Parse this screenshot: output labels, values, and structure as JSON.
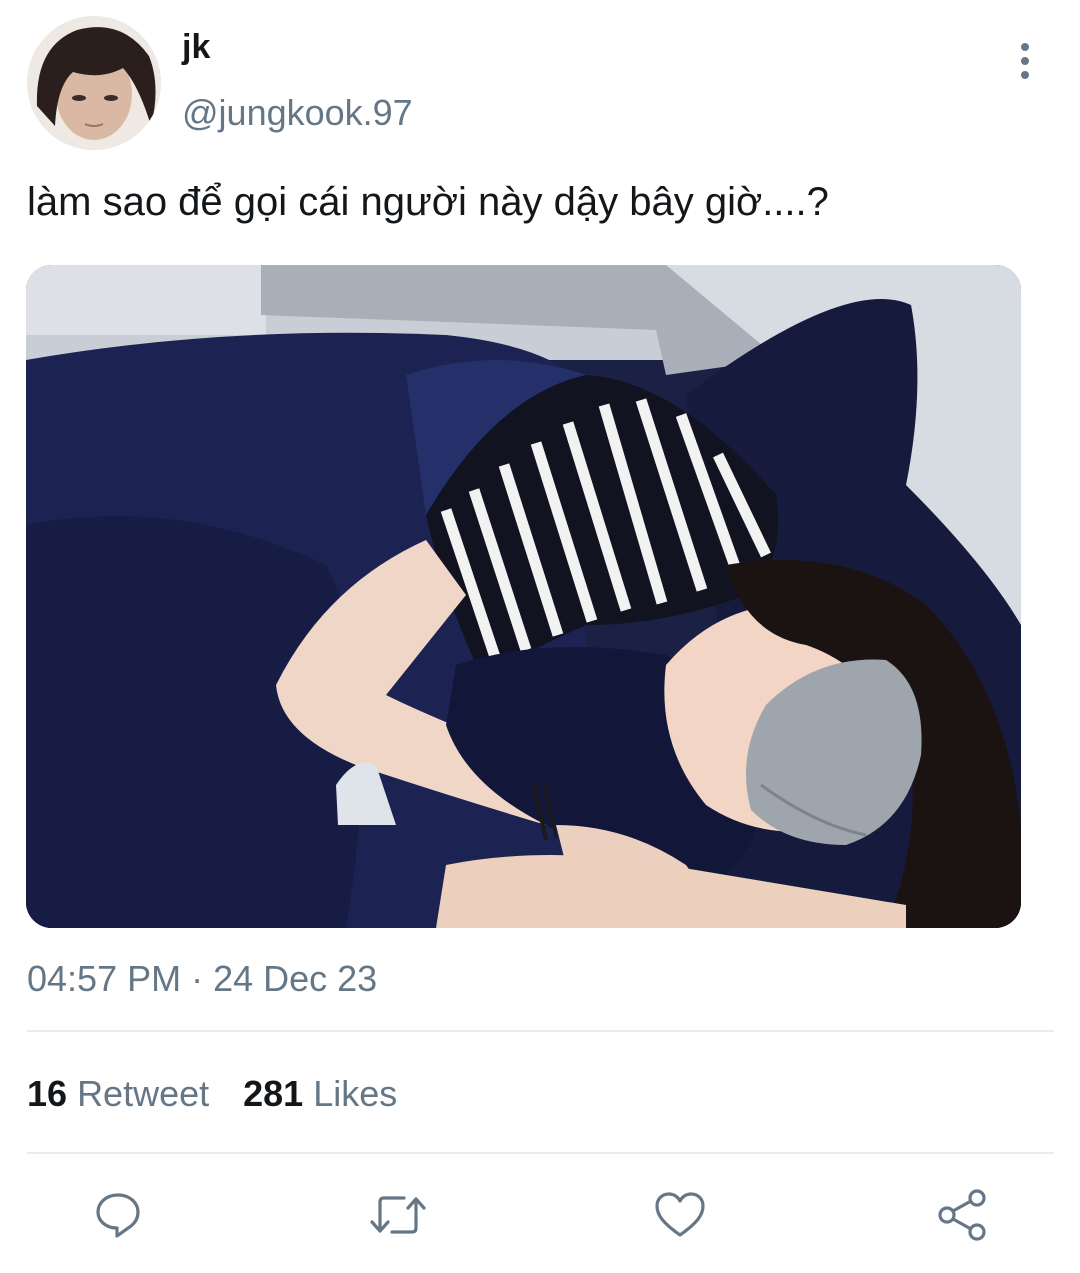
{
  "tweet": {
    "display_name": "jk",
    "handle": "@jungkook.97",
    "text": "làm sao để gọi cái người này dậy bây giờ....?",
    "timestamp": "04:57 PM · 24 Dec 23",
    "stats": {
      "retweets_count": "16",
      "retweets_label": "Retweet",
      "likes_count": "281",
      "likes_label": "Likes"
    }
  },
  "icons": {
    "more": "more-vertical-icon",
    "reply": "reply-icon",
    "retweet": "retweet-icon",
    "like": "heart-icon",
    "share": "share-icon"
  },
  "colors": {
    "text_primary": "#14171a",
    "text_secondary": "#657786",
    "divider": "#e6ecf0",
    "icon": "#657786"
  }
}
